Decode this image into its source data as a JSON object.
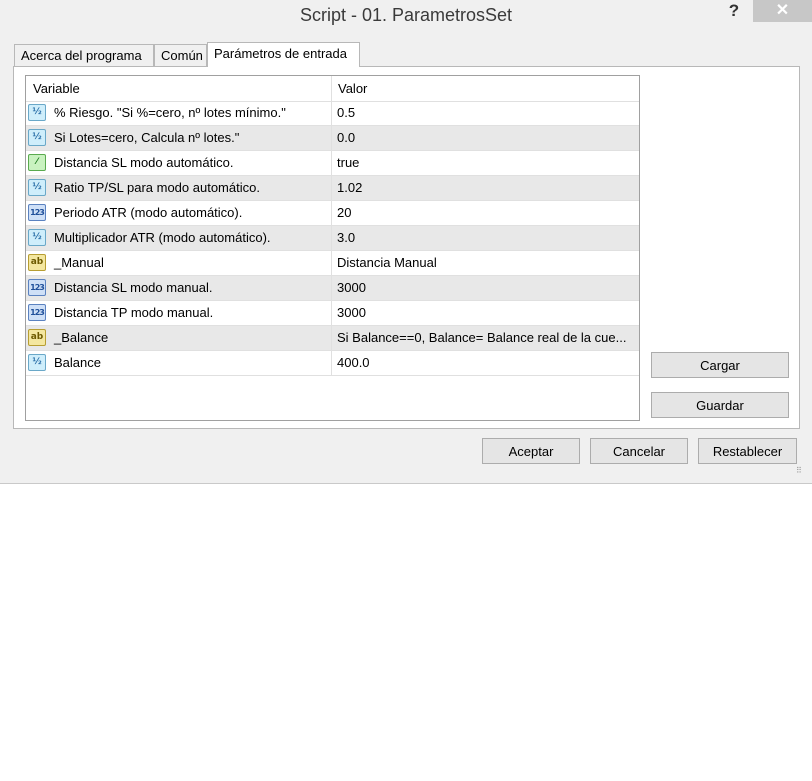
{
  "window": {
    "title": "Script - 01. ParametrosSet",
    "help_glyph": "?",
    "close_glyph": "✕"
  },
  "tabs": [
    {
      "label": "Acerca del programa"
    },
    {
      "label": "Común"
    },
    {
      "label": "Parámetros de entrada",
      "active": true
    }
  ],
  "grid": {
    "columns": {
      "variable": "Variable",
      "value": "Valor"
    },
    "rows": [
      {
        "icon": "double-type-icon",
        "glyph": "½",
        "name": "% Riesgo. \"Si %=cero, nº lotes mínimo.\"",
        "value": "0.5"
      },
      {
        "icon": "double-type-icon",
        "glyph": "½",
        "name": "Si Lotes=cero, Calcula nº lotes.\"",
        "value": "0.0"
      },
      {
        "icon": "bool-type-icon",
        "glyph": "⁄",
        "name": "Distancia SL modo automático.",
        "value": "true"
      },
      {
        "icon": "double-type-icon",
        "glyph": "½",
        "name": "Ratio TP/SL para modo automático.",
        "value": "1.02"
      },
      {
        "icon": "int-type-icon",
        "glyph": "123",
        "name": "Periodo ATR (modo automático).",
        "value": "20"
      },
      {
        "icon": "double-type-icon",
        "glyph": "½",
        "name": "Multiplicador ATR (modo automático).",
        "value": "3.0"
      },
      {
        "icon": "string-type-icon",
        "glyph": "ab",
        "name": "_Manual",
        "value": "Distancia Manual"
      },
      {
        "icon": "int-type-icon",
        "glyph": "123",
        "name": "Distancia SL modo manual.",
        "value": "3000"
      },
      {
        "icon": "int-type-icon",
        "glyph": "123",
        "name": "Distancia TP modo manual.",
        "value": "3000"
      },
      {
        "icon": "string-type-icon",
        "glyph": "ab",
        "name": "_Balance",
        "value": "Si Balance==0, Balance= Balance real de la cue..."
      },
      {
        "icon": "double-type-icon",
        "glyph": "½",
        "name": "Balance",
        "value": "400.0"
      }
    ]
  },
  "side_buttons": {
    "load": "Cargar",
    "save": "Guardar"
  },
  "footer_buttons": {
    "ok": "Aceptar",
    "cancel": "Cancelar",
    "reset": "Restablecer"
  },
  "resize_grip_glyph": "⠿"
}
